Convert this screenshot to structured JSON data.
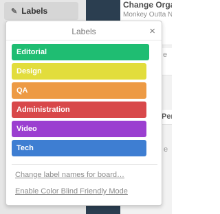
{
  "background": {
    "cards": [
      {
        "title": "Change Organ",
        "subtitle": "Monkey Outta Nu"
      },
      {
        "snippet": "e"
      },
      {
        "snippet": "Per"
      },
      {
        "snippet": "e"
      }
    ]
  },
  "toolbar": {
    "labels_button": "Labels"
  },
  "popover": {
    "title": "Labels",
    "close": "×",
    "labels": [
      {
        "name": "Editorial",
        "color": "#1fbd72"
      },
      {
        "name": "Design",
        "color": "#e2dd3c"
      },
      {
        "name": "QA",
        "color": "#ed9a44"
      },
      {
        "name": "Administration",
        "color": "#d8484a"
      },
      {
        "name": "Video",
        "color": "#9b3fd0"
      },
      {
        "name": "Tech",
        "color": "#3e7ed2"
      }
    ],
    "links": {
      "change_names": "Change label names for board…",
      "color_blind": "Enable Color Blind Friendly Mode"
    }
  }
}
